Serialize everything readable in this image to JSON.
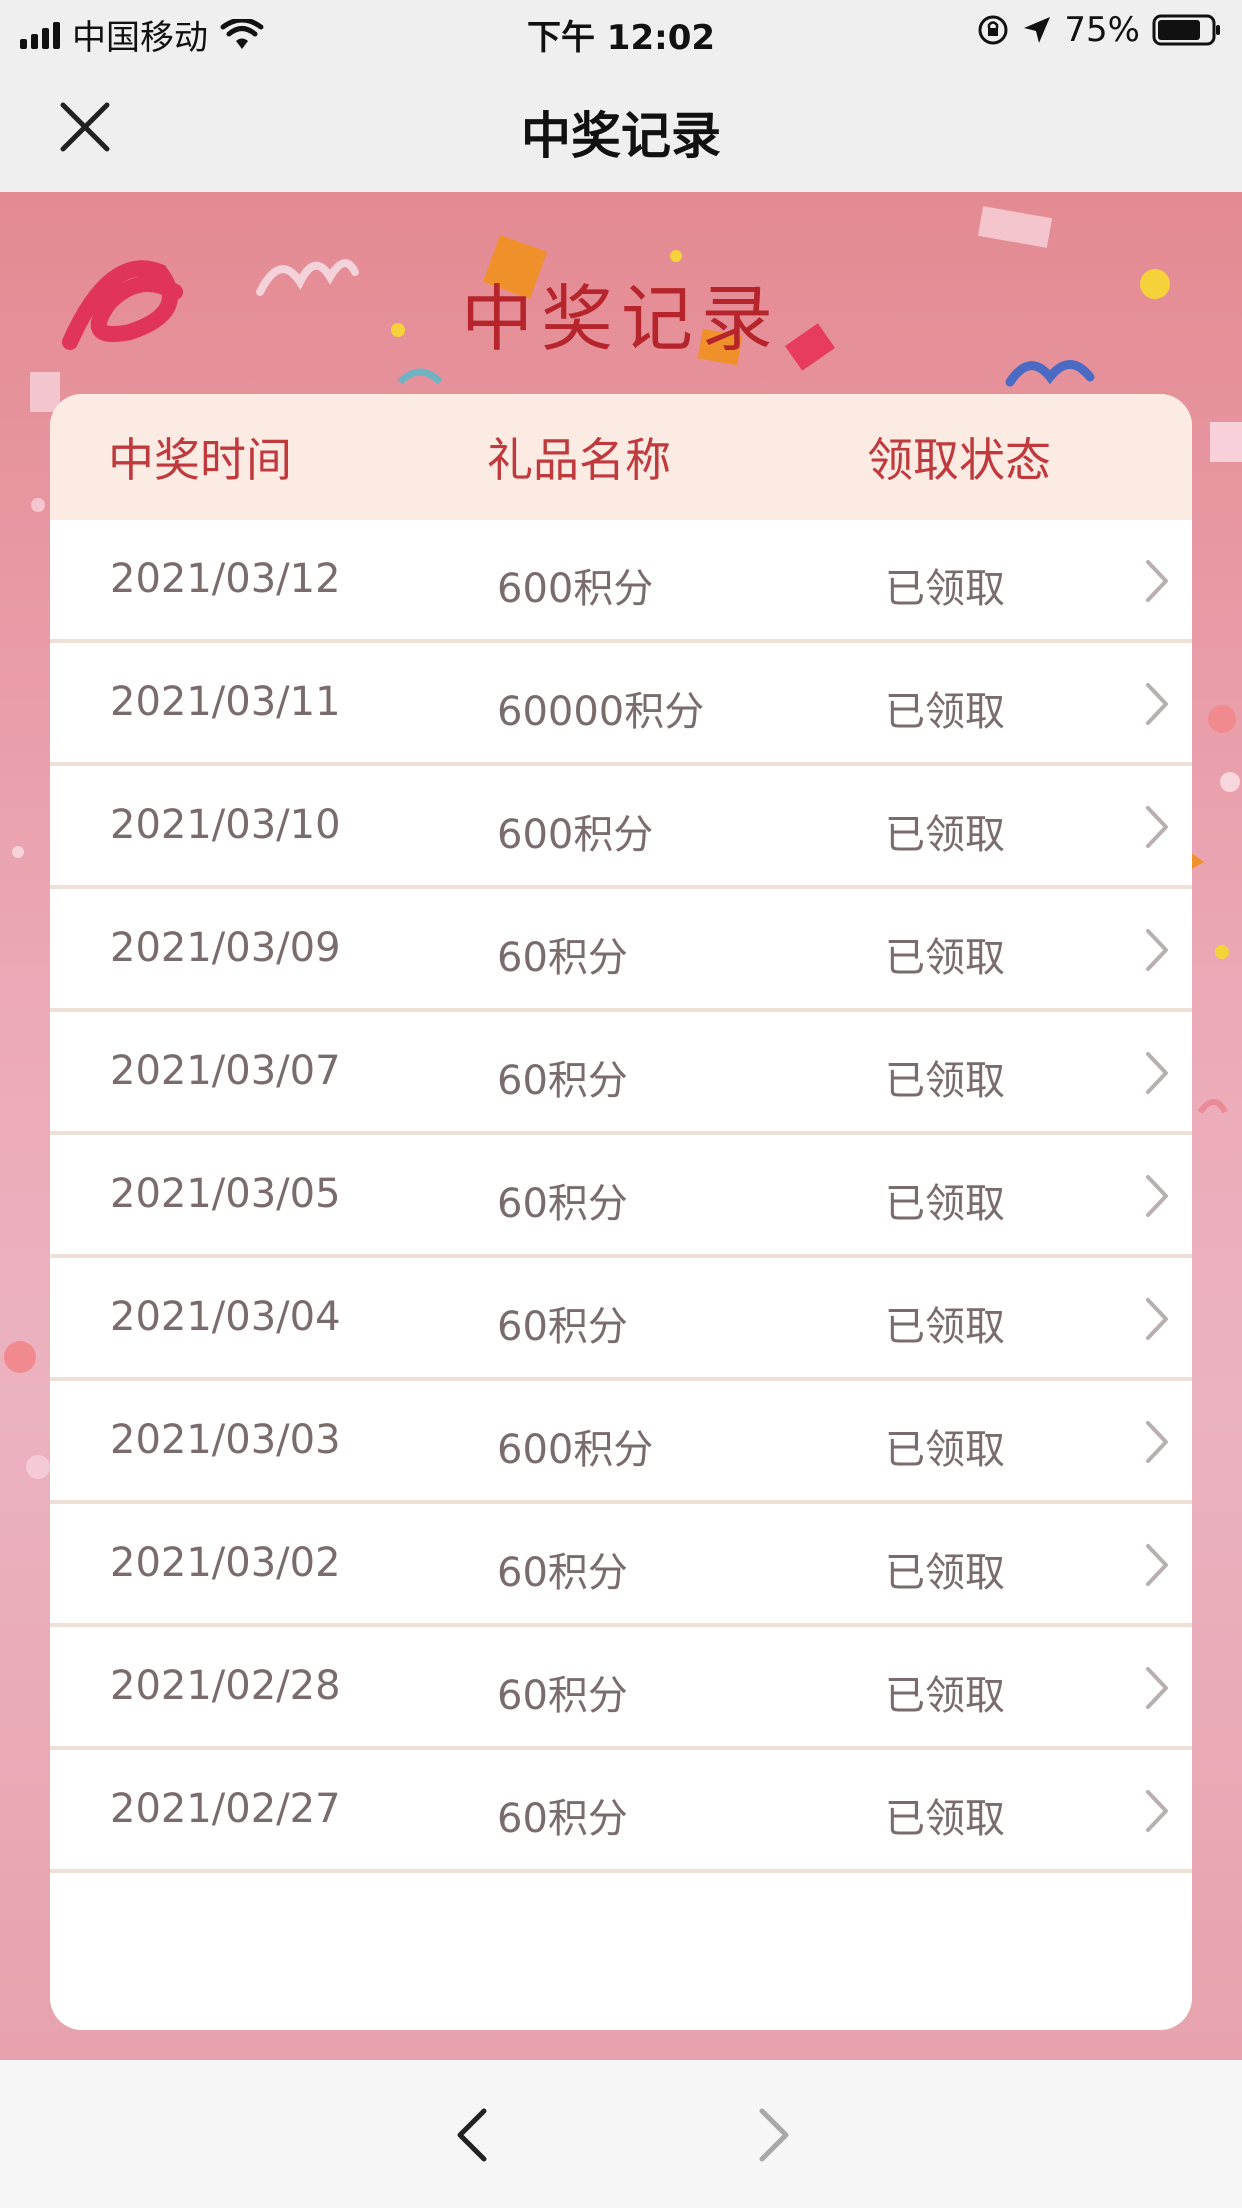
{
  "status_bar": {
    "carrier": "中国移动",
    "time": "下午 12:02",
    "battery": "75%"
  },
  "nav": {
    "title": "中奖记录"
  },
  "hero": {
    "title": "中奖记录"
  },
  "table": {
    "headers": [
      "中奖时间",
      "礼品名称",
      "领取状态"
    ],
    "rows": [
      {
        "date": "2021/03/12",
        "gift": "600积分",
        "status": "已领取"
      },
      {
        "date": "2021/03/11",
        "gift": "60000积分",
        "status": "已领取"
      },
      {
        "date": "2021/03/10",
        "gift": "600积分",
        "status": "已领取"
      },
      {
        "date": "2021/03/09",
        "gift": "60积分",
        "status": "已领取"
      },
      {
        "date": "2021/03/07",
        "gift": "60积分",
        "status": "已领取"
      },
      {
        "date": "2021/03/05",
        "gift": "60积分",
        "status": "已领取"
      },
      {
        "date": "2021/03/04",
        "gift": "60积分",
        "status": "已领取"
      },
      {
        "date": "2021/03/03",
        "gift": "600积分",
        "status": "已领取"
      },
      {
        "date": "2021/03/02",
        "gift": "60积分",
        "status": "已领取"
      },
      {
        "date": "2021/02/28",
        "gift": "60积分",
        "status": "已领取"
      },
      {
        "date": "2021/02/27",
        "gift": "60积分",
        "status": "已领取"
      }
    ]
  },
  "icons": {
    "close": "close-icon",
    "chevron": "chevron-right-icon",
    "back": "back-arrow-icon",
    "forward": "forward-arrow-icon"
  },
  "colors": {
    "accent": "#c0393c",
    "header_bg": "#fbebe3",
    "background": "#e9a0ae"
  }
}
